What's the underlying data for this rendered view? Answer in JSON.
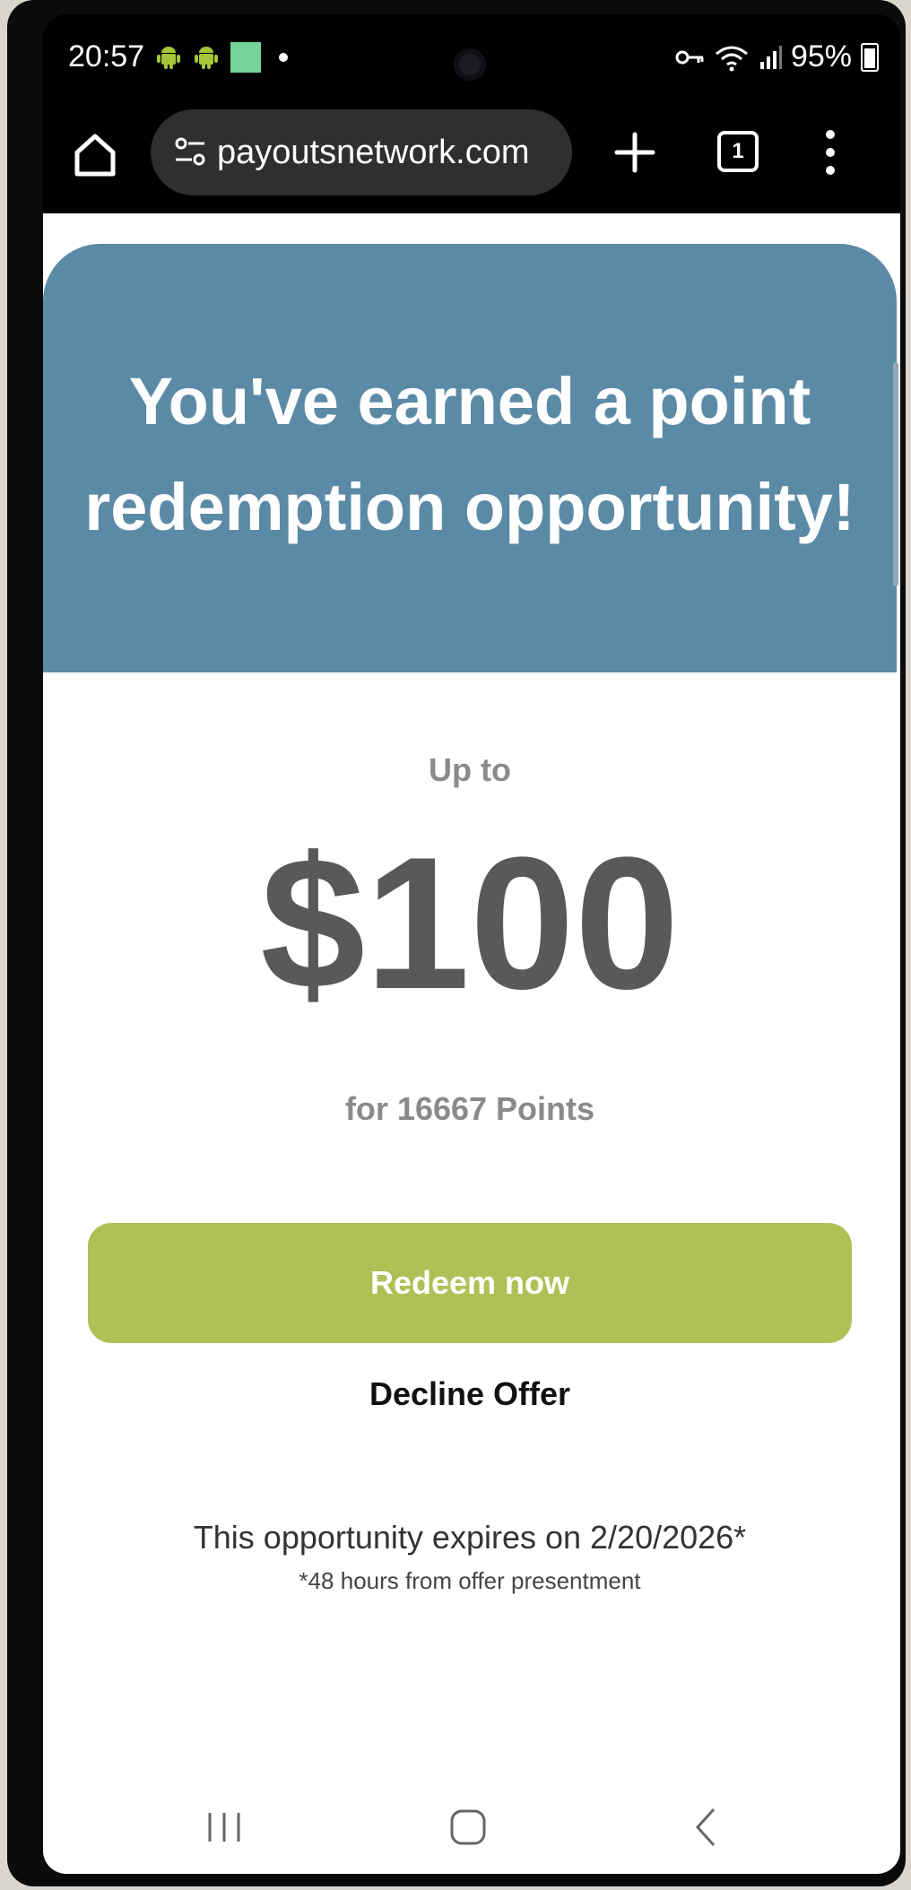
{
  "status_bar": {
    "time": "20:57",
    "battery_percent": "95%",
    "icons": [
      "android-icon",
      "android-icon",
      "notification-square-icon",
      "dot-icon",
      "vpn-key-icon",
      "wifi-icon",
      "signal-icon",
      "battery-icon"
    ]
  },
  "browser": {
    "url": "payoutsnetwork.com",
    "tab_count": "1"
  },
  "offer": {
    "headline": "You've earned a point redemption opportunity!",
    "up_to": "Up to",
    "amount": "$100",
    "points_text": "for 16667 Points",
    "redeem_label": "Redeem now",
    "decline_label": "Decline Offer",
    "expires_text": "This opportunity expires on 2/20/2026*",
    "footnote": "*48 hours from offer presentment"
  },
  "colors": {
    "hero_bg": "#5a8aa6",
    "redeem_bg": "#aec157",
    "amount_text": "#595959"
  }
}
